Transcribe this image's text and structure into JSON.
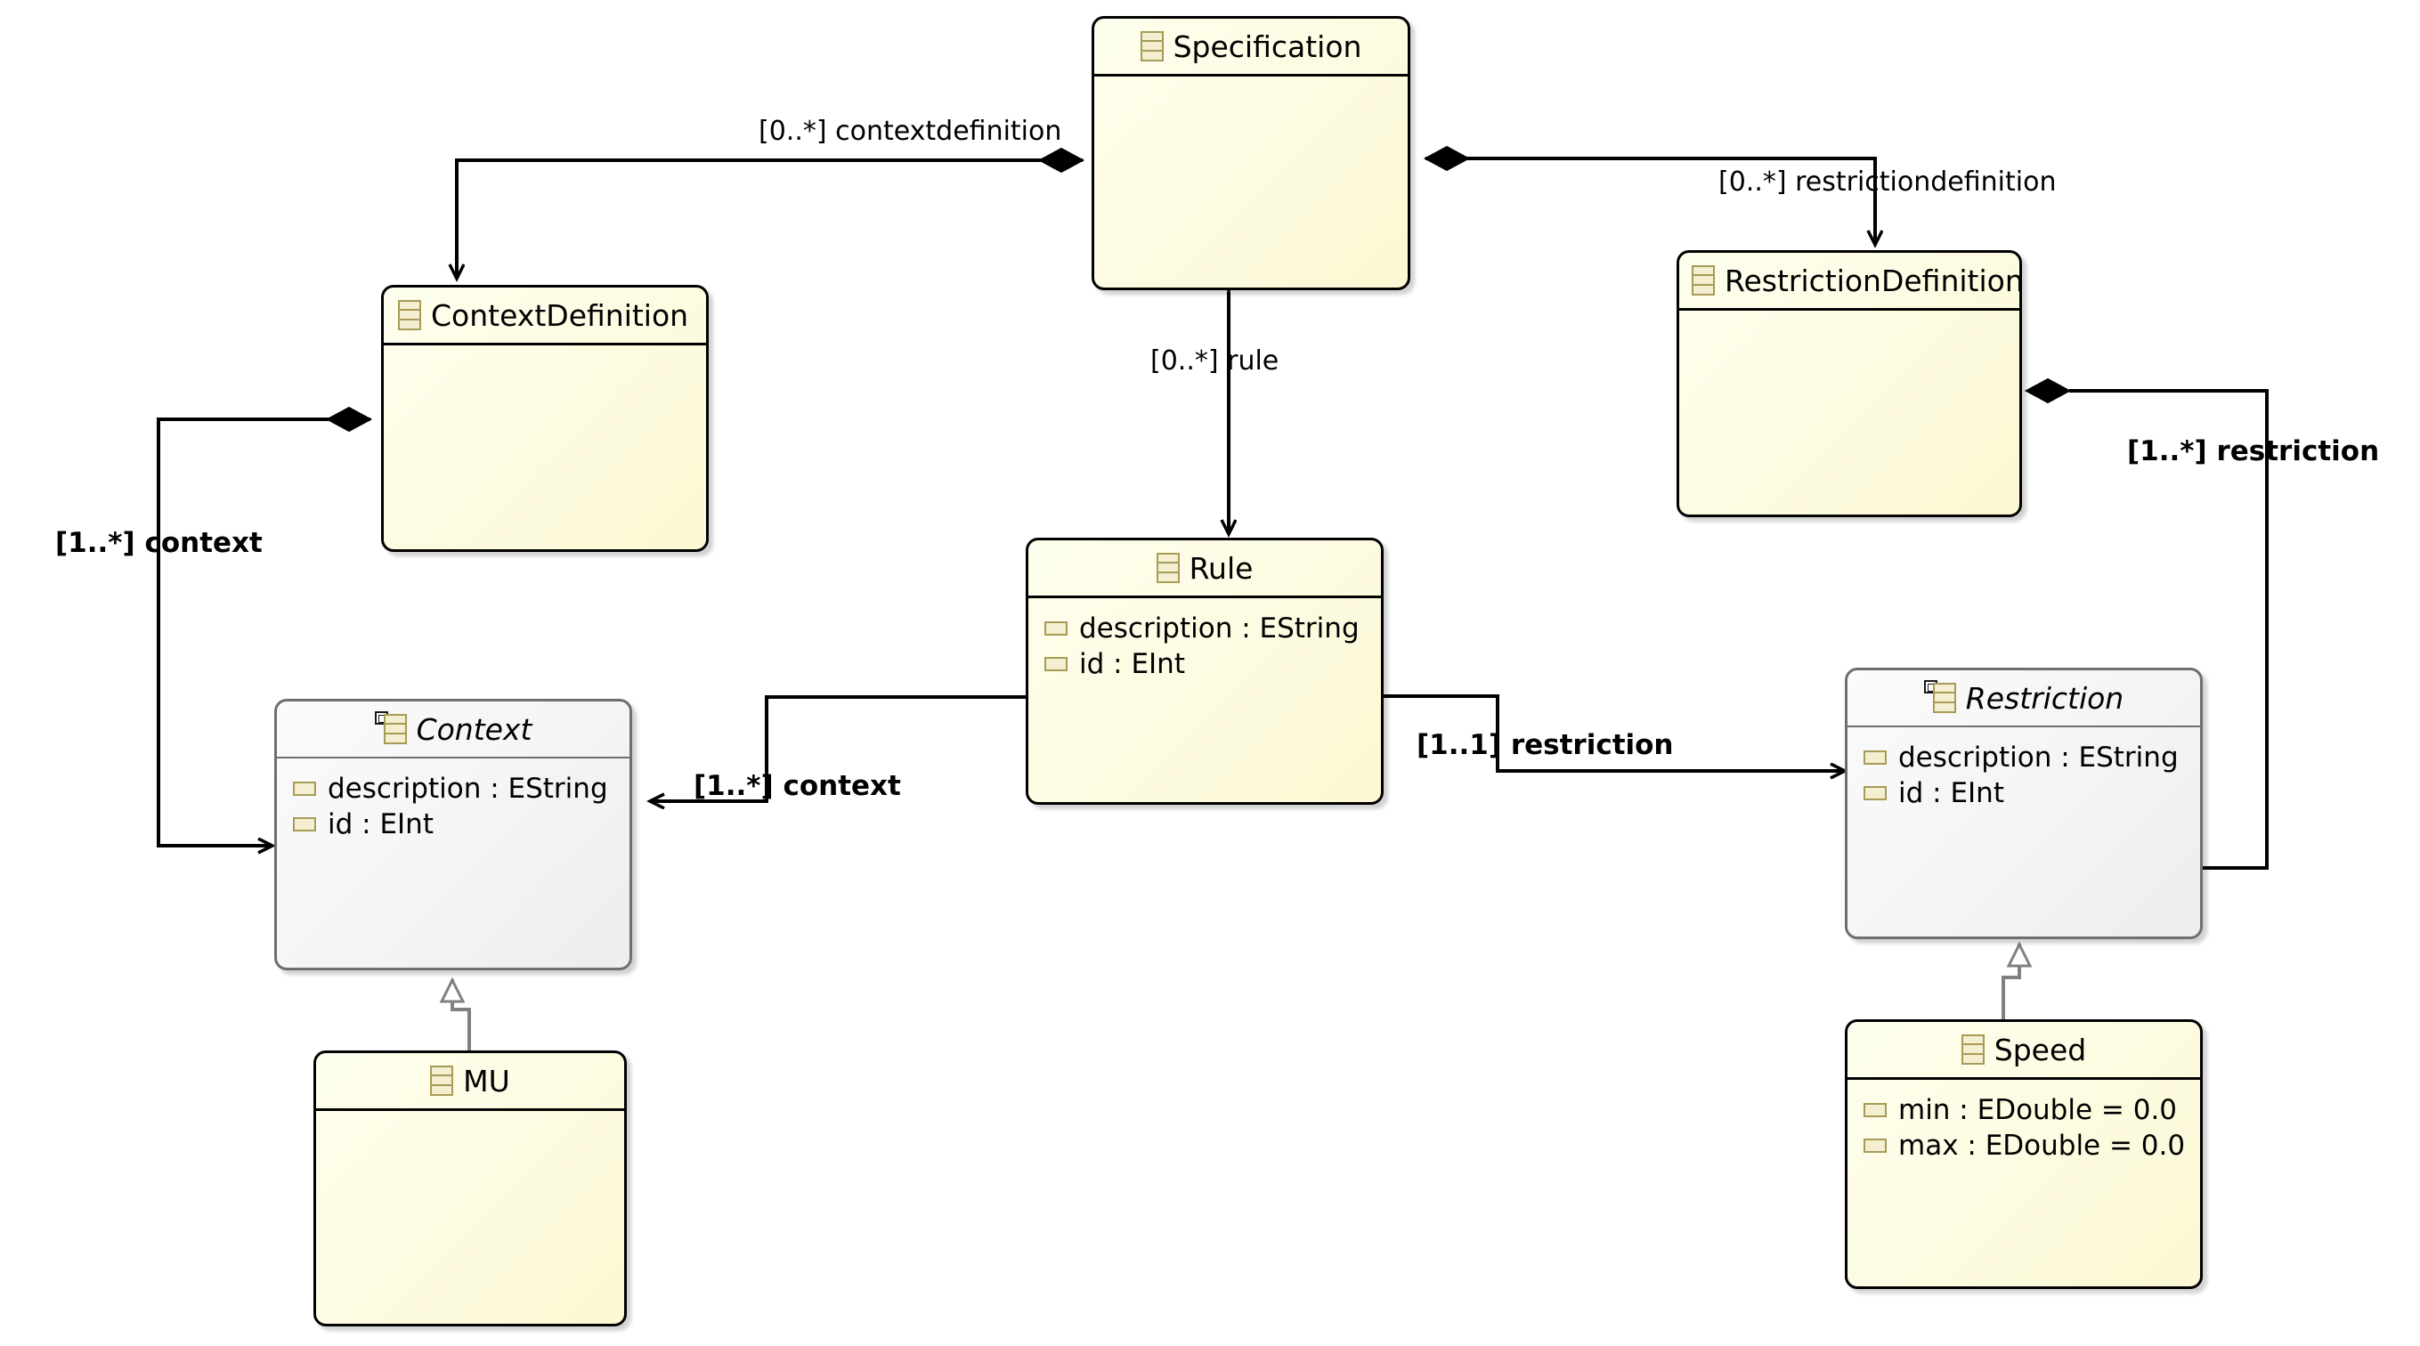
{
  "diagram": {
    "kind": "uml-class-diagram",
    "background": "#ffffff",
    "colors": {
      "class_fill": "#fdfbe0",
      "class_border": "#000000",
      "abstract_fill": "#f4f4f4",
      "abstract_border": "#6e6e6e",
      "edge": "#000000",
      "inheritance_edge": "#808080",
      "icon_fill": "#f3efd0",
      "icon_border": "#a79b57"
    }
  },
  "classes": [
    {
      "id": "specification",
      "name": "Specification",
      "abstract": false,
      "icon": "class-icon",
      "attributes": []
    },
    {
      "id": "contextdefinition",
      "name": "ContextDefinition",
      "abstract": false,
      "icon": "class-icon",
      "attributes": []
    },
    {
      "id": "restrictiondefinition",
      "name": "RestrictionDefinition",
      "abstract": false,
      "icon": "class-icon",
      "attributes": []
    },
    {
      "id": "rule",
      "name": "Rule",
      "abstract": false,
      "icon": "class-icon",
      "attributes": [
        {
          "label": "description : EString",
          "icon": "attribute-icon"
        },
        {
          "label": "id : EInt",
          "icon": "attribute-icon"
        }
      ]
    },
    {
      "id": "context",
      "name": "Context",
      "abstract": true,
      "icon": "abstract-class-icon",
      "attributes": [
        {
          "label": "description : EString",
          "icon": "attribute-icon"
        },
        {
          "label": "id : EInt",
          "icon": "attribute-icon"
        }
      ]
    },
    {
      "id": "restriction",
      "name": "Restriction",
      "abstract": true,
      "icon": "abstract-class-icon",
      "attributes": [
        {
          "label": "description : EString",
          "icon": "attribute-icon"
        },
        {
          "label": "id : EInt",
          "icon": "attribute-icon"
        }
      ]
    },
    {
      "id": "mu",
      "name": "MU",
      "abstract": false,
      "icon": "class-icon",
      "attributes": []
    },
    {
      "id": "speed",
      "name": "Speed",
      "abstract": false,
      "icon": "class-icon",
      "attributes": [
        {
          "label": "min : EDouble = 0.0",
          "icon": "attribute-icon"
        },
        {
          "label": "max : EDouble = 0.0",
          "icon": "attribute-icon"
        }
      ]
    }
  ],
  "relations": [
    {
      "id": "spec-contextdefinition",
      "from": "specification",
      "to": "contextdefinition",
      "type": "composition",
      "label": "[0..*] contextdefinition",
      "bold": false
    },
    {
      "id": "spec-restrictiondefinition",
      "from": "specification",
      "to": "restrictiondefinition",
      "type": "composition",
      "label": "[0..*] restrictiondefinition",
      "bold": false
    },
    {
      "id": "spec-rule",
      "from": "specification",
      "to": "rule",
      "type": "composition",
      "label": "[0..*] rule",
      "bold": false
    },
    {
      "id": "contextdefinition-context",
      "from": "contextdefinition",
      "to": "context",
      "type": "composition",
      "label": "[1..*] context",
      "bold": true
    },
    {
      "id": "rule-context",
      "from": "rule",
      "to": "context",
      "type": "association",
      "label": "[1..*] context",
      "bold": true
    },
    {
      "id": "rule-restriction",
      "from": "rule",
      "to": "restriction",
      "type": "association",
      "label": "[1..1] restriction",
      "bold": true
    },
    {
      "id": "restrictiondefinition-restriction",
      "from": "restrictiondefinition",
      "to": "restriction",
      "type": "composition",
      "label": "[1..*] restriction",
      "bold": true
    },
    {
      "id": "mu-context",
      "from": "mu",
      "to": "context",
      "type": "inheritance",
      "label": "",
      "bold": false
    },
    {
      "id": "speed-restriction",
      "from": "speed",
      "to": "restriction",
      "type": "inheritance",
      "label": "",
      "bold": false
    }
  ]
}
